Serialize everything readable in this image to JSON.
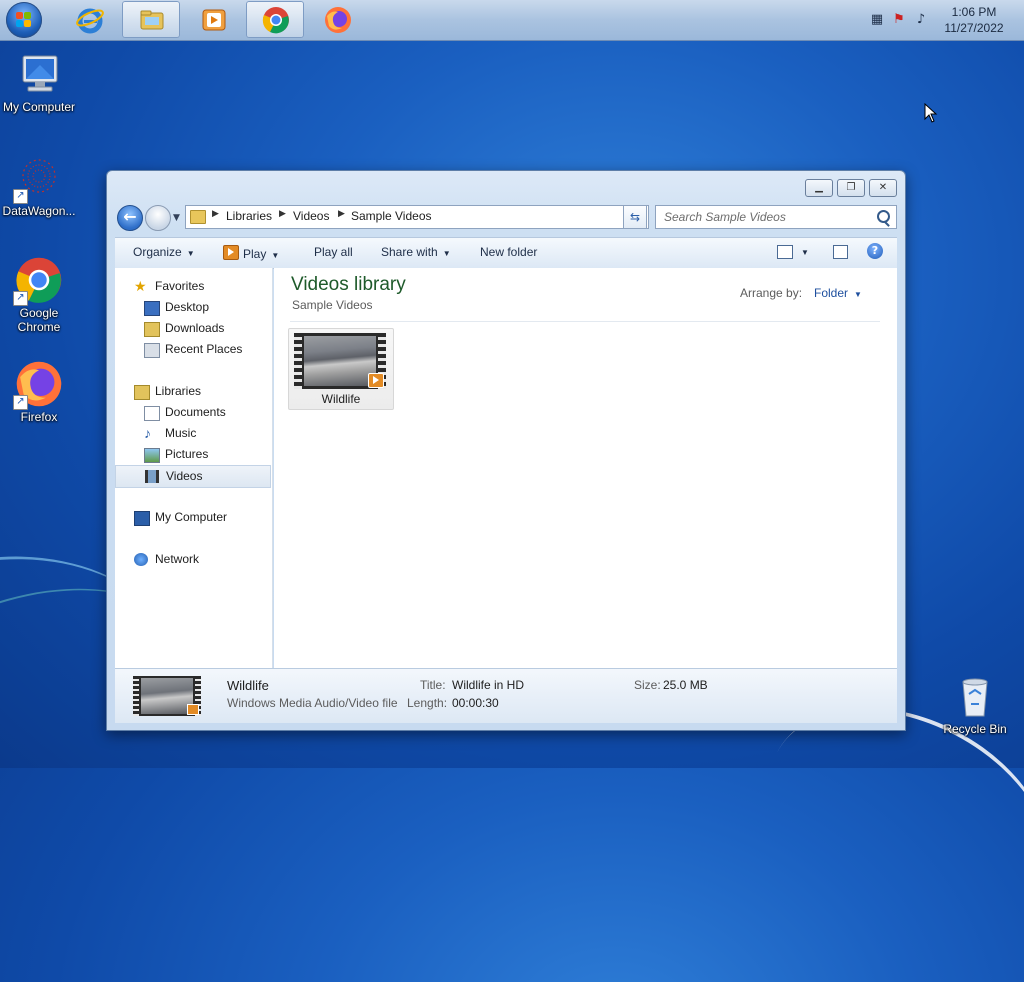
{
  "taskbar": {
    "apps": [
      {
        "name": "Internet Explorer",
        "icon": "ie-icon",
        "active": false
      },
      {
        "name": "Windows Explorer",
        "icon": "folder-icon",
        "active": true
      },
      {
        "name": "Windows Media Player",
        "icon": "media-player-icon",
        "active": false
      },
      {
        "name": "Google Chrome",
        "icon": "chrome-icon",
        "active": true
      },
      {
        "name": "Firefox",
        "icon": "firefox-icon",
        "active": false
      }
    ],
    "clock": {
      "time": "1:06 PM",
      "date": "11/27/2022"
    }
  },
  "desktop": {
    "icons": [
      {
        "label": "My Computer",
        "icon": "computer-icon"
      },
      {
        "label": "DataWagon...",
        "icon": "datawagon-icon"
      },
      {
        "label": "Google Chrome",
        "icon": "chrome-icon"
      },
      {
        "label": "Firefox",
        "icon": "firefox-icon"
      },
      {
        "label": "Recycle Bin",
        "icon": "recycle-bin-icon"
      }
    ]
  },
  "explorer": {
    "address": {
      "crumbs": [
        "Libraries",
        "Videos",
        "Sample Videos"
      ]
    },
    "search_placeholder": "Search Sample Videos",
    "commands": {
      "organize": "Organize",
      "play": "Play",
      "play_all": "Play all",
      "share_with": "Share with",
      "new_folder": "New folder"
    },
    "nav": {
      "favorites": "Favorites",
      "desktop": "Desktop",
      "downloads": "Downloads",
      "recent": "Recent Places",
      "libraries": "Libraries",
      "documents": "Documents",
      "music": "Music",
      "pictures": "Pictures",
      "videos": "Videos",
      "computer": "My Computer",
      "network": "Network"
    },
    "content": {
      "title": "Videos library",
      "subtitle": "Sample Videos",
      "arrange_label": "Arrange by:",
      "arrange_value": "Folder",
      "files": [
        {
          "name": "Wildlife"
        }
      ]
    },
    "details": {
      "name": "Wildlife",
      "type": "Windows Media Audio/Video file",
      "title_label": "Title:",
      "title_value": "Wildlife in HD",
      "length_label": "Length:",
      "length_value": "00:00:30",
      "size_label": "Size:",
      "size_value": "25.0 MB"
    }
  }
}
